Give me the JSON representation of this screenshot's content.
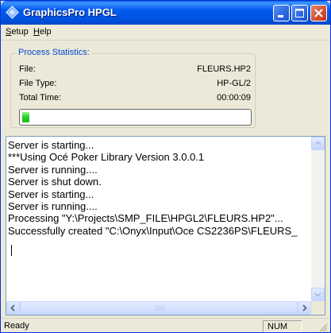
{
  "window": {
    "title": "GraphicsPro HPGL",
    "icon": "diamond-app-icon"
  },
  "menu": {
    "items": [
      {
        "label": "Setup",
        "accel": "S"
      },
      {
        "label": "Help",
        "accel": "H"
      }
    ]
  },
  "stats": {
    "group_title": "Process Statistics:",
    "file_label": "File:",
    "file_value": "FLEURS.HP2",
    "filetype_label": "File Type:",
    "filetype_value": "HP-GL/2",
    "time_label": "Total Time:",
    "time_value": "00:00:09",
    "progress_fraction": 0.03
  },
  "log": {
    "lines": [
      "Server is starting...",
      "***Using Océ Poker Library Version 3.0.0.1",
      "Server is running....",
      "Server is shut down.",
      "Server is starting...",
      "Server is running....",
      "Processing \"Y:\\Projects\\SMP_FILE\\HPGL2\\FLEURS.HP2\"...",
      "Successfully created \"C:\\Onyx\\Input\\Oce CS2236PS\\FLEURS_"
    ]
  },
  "status": {
    "text": "Ready",
    "num": "NUM"
  }
}
